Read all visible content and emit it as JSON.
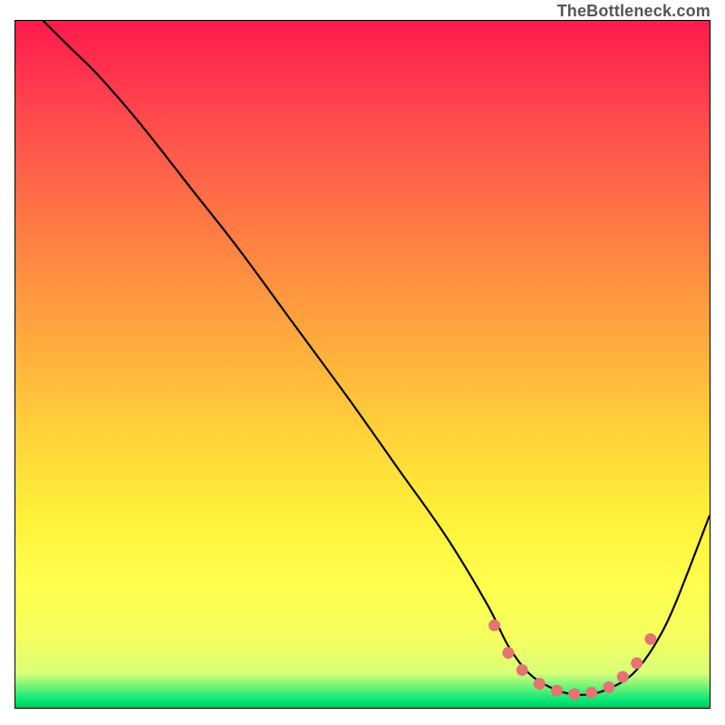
{
  "attribution": "TheBottleneck.com",
  "chart_data": {
    "type": "line",
    "title": "",
    "xlabel": "",
    "ylabel": "",
    "xlim": [
      0,
      100
    ],
    "ylim": [
      0,
      100
    ],
    "series": [
      {
        "name": "bottleneck-curve",
        "x": [
          4,
          8,
          12,
          18,
          25,
          32,
          40,
          48,
          55,
          62,
          68,
          71,
          74,
          77,
          80,
          83,
          86,
          89,
          92,
          95,
          100
        ],
        "y": [
          100,
          96,
          92,
          85,
          76,
          67,
          56,
          45,
          35,
          25,
          15,
          9,
          5,
          3,
          2,
          2,
          3,
          5,
          9,
          15,
          28
        ]
      }
    ],
    "markers": {
      "name": "highlighted-points",
      "x": [
        69,
        71,
        73,
        75.5,
        78,
        80.5,
        83,
        85.5,
        87.5,
        89.5,
        91.5
      ],
      "y": [
        12,
        8,
        5.5,
        3.5,
        2.5,
        2,
        2.2,
        3,
        4.5,
        6.5,
        10
      ]
    },
    "background_gradient": {
      "top": "#ff1a4d",
      "bottom": "#00c853"
    }
  }
}
